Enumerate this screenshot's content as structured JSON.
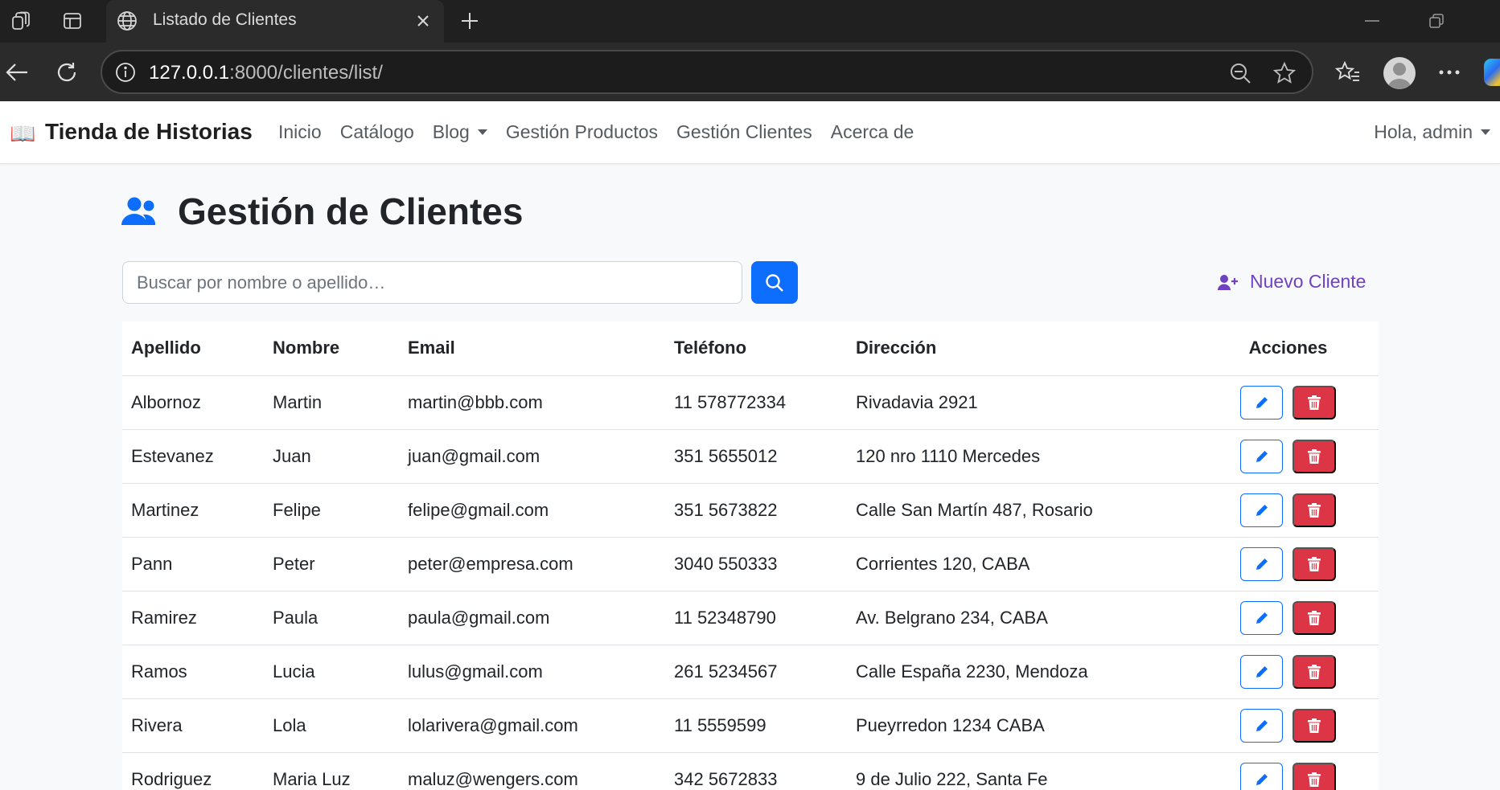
{
  "browser": {
    "tab_title": "Listado de Clientes",
    "url_host": "127.0.0.1",
    "url_rest": ":8000/clientes/list/"
  },
  "navbar": {
    "brand_icon": "📖",
    "brand": "Tienda de Historias",
    "links": [
      "Inicio",
      "Catálogo",
      "Blog",
      "Gestión Productos",
      "Gestión Clientes",
      "Acerca de"
    ],
    "user_menu": "Hola, admin"
  },
  "page": {
    "title": "Gestión de Clientes",
    "search_placeholder": "Buscar por nombre o apellido…",
    "new_client_label": "Nuevo Cliente"
  },
  "table": {
    "headers": [
      "Apellido",
      "Nombre",
      "Email",
      "Teléfono",
      "Dirección",
      "Acciones"
    ],
    "rows": [
      [
        "Albornoz",
        "Martin",
        "martin@bbb.com",
        "11 578772334",
        "Rivadavia 2921"
      ],
      [
        "Estevanez",
        "Juan",
        "juan@gmail.com",
        "351 5655012",
        "120 nro 1110 Mercedes"
      ],
      [
        "Martinez",
        "Felipe",
        "felipe@gmail.com",
        "351 5673822",
        "Calle San Martín 487, Rosario"
      ],
      [
        "Pann",
        "Peter",
        "peter@empresa.com",
        "3040 550333",
        "Corrientes 120, CABA"
      ],
      [
        "Ramirez",
        "Paula",
        "paula@gmail.com",
        "11 52348790",
        "Av. Belgrano 234, CABA"
      ],
      [
        "Ramos",
        "Lucia",
        "lulus@gmail.com",
        "261 5234567",
        "Calle España 2230, Mendoza"
      ],
      [
        "Rivera",
        "Lola",
        "lolarivera@gmail.com",
        "11 5559599",
        "Pueyrredon 1234 CABA"
      ],
      [
        "Rodriguez",
        "Maria Luz",
        "maluz@wengers.com",
        "342 5672833",
        "9 de Julio 222, Santa Fe"
      ]
    ]
  },
  "colors": {
    "primary": "#0d6efd",
    "danger": "#dc3545",
    "accent_purple": "#6f42c1"
  },
  "icons": {
    "edit": "pencil-icon",
    "delete": "trash-icon",
    "search": "search-icon",
    "title": "users-icon",
    "new_client": "user-plus-icon"
  }
}
